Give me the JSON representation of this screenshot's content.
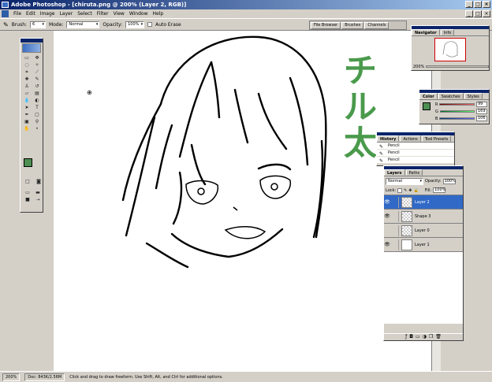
{
  "window": {
    "title": "Adobe Photoshop - [chiruta.png @ 200% (Layer 2, RGB)]",
    "buttons": [
      "_",
      "□",
      "×"
    ]
  },
  "menu": [
    "File",
    "Edit",
    "Image",
    "Layer",
    "Select",
    "Filter",
    "View",
    "Window",
    "Help"
  ],
  "options": {
    "brush_label": "Brush:",
    "brush_value": "6",
    "mode_label": "Mode:",
    "mode_value": "Normal",
    "opacity_label": "Opacity:",
    "opacity_value": "100%",
    "auto_erase_label": "Auto Erase"
  },
  "palette_well": [
    "File Browser",
    "Brushes",
    "Channels"
  ],
  "navigator": {
    "tabs": [
      "Navigator",
      "Info"
    ],
    "zoom": "200%"
  },
  "color": {
    "tabs": [
      "Color",
      "Swatches",
      "Styles"
    ],
    "r_label": "R",
    "r_value": "99",
    "g_label": "G",
    "g_value": "169",
    "b_label": "B",
    "b_value": "106",
    "fg": "#4e8f52"
  },
  "history": {
    "tabs": [
      "History",
      "Actions",
      "Tool Presets"
    ],
    "items": [
      "Pencil",
      "Pencil",
      "Pencil"
    ]
  },
  "layers": {
    "tabs": [
      "Layers",
      "Paths"
    ],
    "blend": "Normal",
    "opacity_label": "Opacity:",
    "opacity_value": "100%",
    "lock_label": "Lock:",
    "fill_label": "Fill:",
    "fill_value": "100%",
    "items": [
      {
        "name": "Layer 2",
        "visible": true,
        "selected": true
      },
      {
        "name": "Shape 3",
        "visible": true,
        "selected": false
      },
      {
        "name": "Layer 0",
        "visible": false,
        "selected": false
      },
      {
        "name": "Layer 1",
        "visible": true,
        "selected": false
      }
    ]
  },
  "canvas": {
    "handwriting": [
      "チ",
      "ル",
      "太"
    ],
    "ink_color": "#4a9a4c"
  },
  "status": {
    "zoom": "200%",
    "doc": "Doc: 843K/2.56M",
    "hint": "Click and drag to draw freeform. Use Shift, Alt, and Ctrl for additional options."
  }
}
